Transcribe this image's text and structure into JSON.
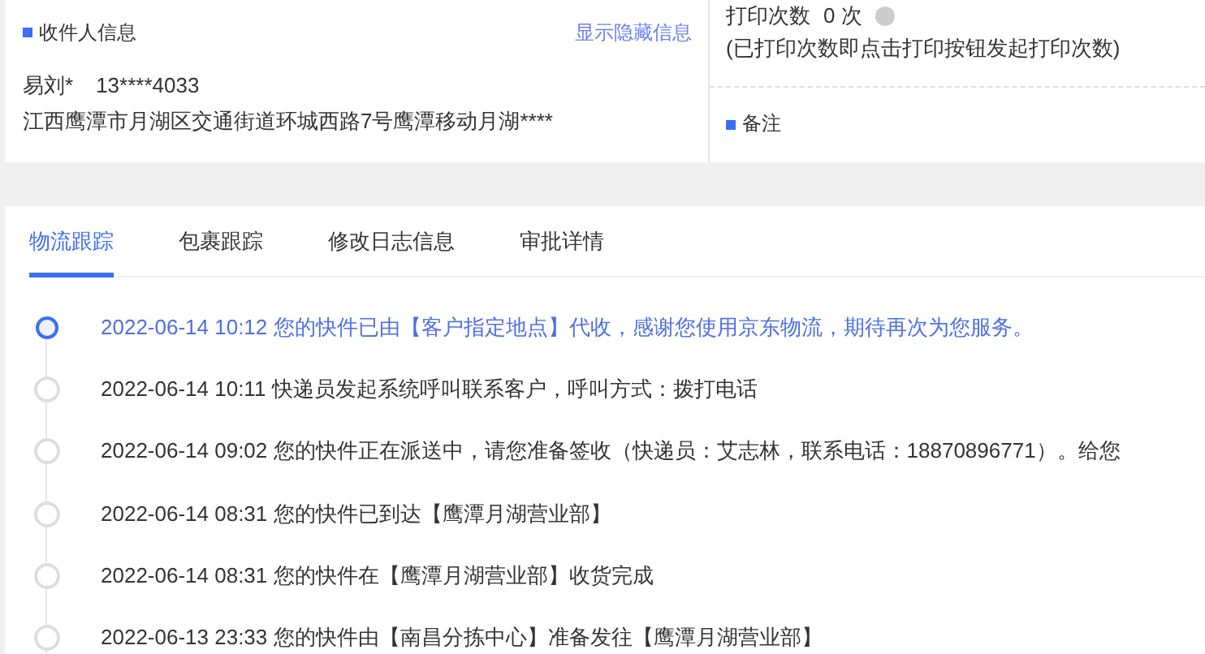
{
  "recipient": {
    "title": "收件人信息",
    "toggle_link": "显示隐藏信息",
    "name": "易刘*",
    "phone": "13****4033",
    "address": "江西鹰潭市月湖区交通街道环城西路7号鹰潭移动月湖****"
  },
  "print": {
    "label": "打印次数",
    "count": "0 次",
    "note": "(已打印次数即点击打印按钮发起打印次数)"
  },
  "remarks": {
    "title": "备注"
  },
  "tabs": [
    {
      "label": "物流跟踪",
      "selected": true
    },
    {
      "label": "包裹跟踪",
      "selected": false
    },
    {
      "label": "修改日志信息",
      "selected": false
    },
    {
      "label": "审批详情",
      "selected": false
    }
  ],
  "timeline": [
    {
      "time": "2022-06-14 10:12",
      "text": "您的快件已由【客户指定地点】代收，感谢您使用京东物流，期待再次为您服务。",
      "selected": true
    },
    {
      "time": "2022-06-14 10:11",
      "text": "快递员发起系统呼叫联系客户，呼叫方式：拨打电话",
      "selected": false
    },
    {
      "time": "2022-06-14 09:02",
      "text": "您的快件正在派送中，请您准备签收（快递员：艾志林，联系电话：18870896771）。给您",
      "selected": false
    },
    {
      "time": "2022-06-14 08:31",
      "text": "您的快件已到达【鹰潭月湖营业部】",
      "selected": false
    },
    {
      "time": "2022-06-14 08:31",
      "text": "您的快件在【鹰潭月湖营业部】收货完成",
      "selected": false
    },
    {
      "time": "2022-06-13 23:33",
      "text": "您的快件由【南昌分拣中心】准备发往【鹰潭月湖营业部】",
      "selected": false
    }
  ]
}
